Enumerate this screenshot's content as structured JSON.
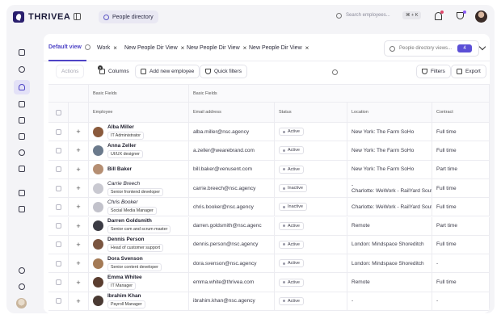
{
  "app": {
    "name": "THRIVEA"
  },
  "breadcrumb": {
    "label": "People directory"
  },
  "top_search": {
    "placeholder": "Search employees...",
    "shortcut": "⌘ + K"
  },
  "tabs": [
    {
      "label": "Default view",
      "active": true
    },
    {
      "label": "Work"
    },
    {
      "label": "New People Dir View"
    },
    {
      "label": "New People Dir View"
    },
    {
      "label": "New People Dir View"
    }
  ],
  "views": {
    "placeholder": "People directory views...",
    "count": "4"
  },
  "toolbar": {
    "actions": "Actions",
    "columns": "Columns",
    "columns_badge": "2",
    "add": "Add new employee",
    "quick_filters": "Quick filters",
    "filters": "Filters",
    "export": "Export"
  },
  "table": {
    "group_headers": [
      "Basic Fields",
      "Basic Fields"
    ],
    "headers": {
      "employee": "Employee",
      "email": "Email address",
      "status": "Status",
      "location": "Location",
      "contract": "Contract"
    },
    "rows": [
      {
        "name": "Alba Miller",
        "role": "IT Administrator",
        "email": "alba.miller@nsc.agency",
        "status": "Active",
        "location": "New York: The Farm SoHo",
        "location2": "",
        "contract": "Full time",
        "muted": false,
        "avatar": "#8a5a3c"
      },
      {
        "name": "Anna Zeller",
        "role": "UI/UX designer",
        "email": "a.zeller@wearebrand.com",
        "status": "Active",
        "location": "New York: The Farm SoHo",
        "location2": "",
        "contract": "Full time",
        "muted": false,
        "avatar": "#6b7a8c"
      },
      {
        "name": "Bill Baker",
        "role": "",
        "email": "bill.baker@venusent.com",
        "status": "Active",
        "location": "New York: The Farm SoHo",
        "location2": "",
        "contract": "Part time",
        "muted": false,
        "avatar": "#b58e72"
      },
      {
        "name": "Carrie Breech",
        "role": "Senior frontend developer",
        "email": "carrie.breech@nsc.agency",
        "status": "Inactive",
        "location": "-",
        "location2": "Charlotte: WeWork - RailYard Sout",
        "contract": "Full time",
        "muted": true,
        "avatar": "#c9c9d1"
      },
      {
        "name": "Chris Booker",
        "role": "Social Media Manager",
        "email": "chris.booker@nsc.agency",
        "status": "Inactive",
        "location": "Charlotte: WeWork - RailYard Sout",
        "location2": "",
        "contract": "Full time",
        "muted": true,
        "avatar": "#c2c2cb"
      },
      {
        "name": "Darren Goldsmith",
        "role": "Senior csm and scrum master",
        "email": "darren.goldsmith@nsc.agenc",
        "status": "Active",
        "location": "Remote",
        "location2": "",
        "contract": "Part time",
        "muted": false,
        "avatar": "#3b3b44"
      },
      {
        "name": "Dennis Person",
        "role": "Head of customer support",
        "email": "dennis.person@nsc.agency",
        "status": "Active",
        "location": "London: Mindspace Shoreditch",
        "location2": "",
        "contract": "Full time",
        "muted": false,
        "avatar": "#7a5540"
      },
      {
        "name": "Dora Svenson",
        "role": "Senior content developer",
        "email": "dora.svenson@nsc.agency",
        "status": "Active",
        "location": "London: Mindspace Shoreditch",
        "location2": "",
        "contract": "-",
        "muted": false,
        "avatar": "#a47a55"
      },
      {
        "name": "Emma Whitee",
        "role": "IT Manager",
        "email": "emma.white@thrivea.com",
        "status": "Active",
        "location": "Remote",
        "location2": "",
        "contract": "Full time",
        "muted": false,
        "avatar": "#5a3d2f"
      },
      {
        "name": "Ibrahim Khan",
        "role": "Payroll Manager",
        "email": "ibrahim.khan@nsc.agency",
        "status": "Active",
        "location": "-",
        "location2": "",
        "contract": "-",
        "muted": false,
        "avatar": "#4a3a33"
      }
    ]
  }
}
